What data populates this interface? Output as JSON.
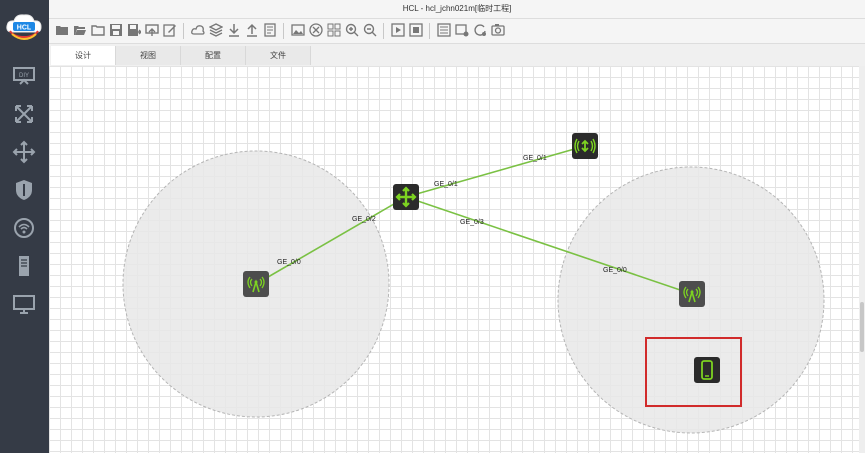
{
  "window": {
    "title": "HCL - hcl_jchn021m[临时工程]"
  },
  "logo": {
    "text": "HCL"
  },
  "tabs": [
    {
      "label": "设计",
      "active": true
    },
    {
      "label": "视图",
      "active": false
    },
    {
      "label": "配置",
      "active": false
    },
    {
      "label": "文件",
      "active": false
    }
  ],
  "links": {
    "core_ap_top": "GE_0/1",
    "core_top_end": "GE_0/1",
    "core_left": "GE_0/2",
    "left_ap": "GE_0/0",
    "core_right": "GE_0/3",
    "right_ap": "GE_0/0"
  },
  "colors": {
    "link": "#7ac143",
    "accent_green": "#7dd321",
    "selection": "#d12b2b"
  }
}
